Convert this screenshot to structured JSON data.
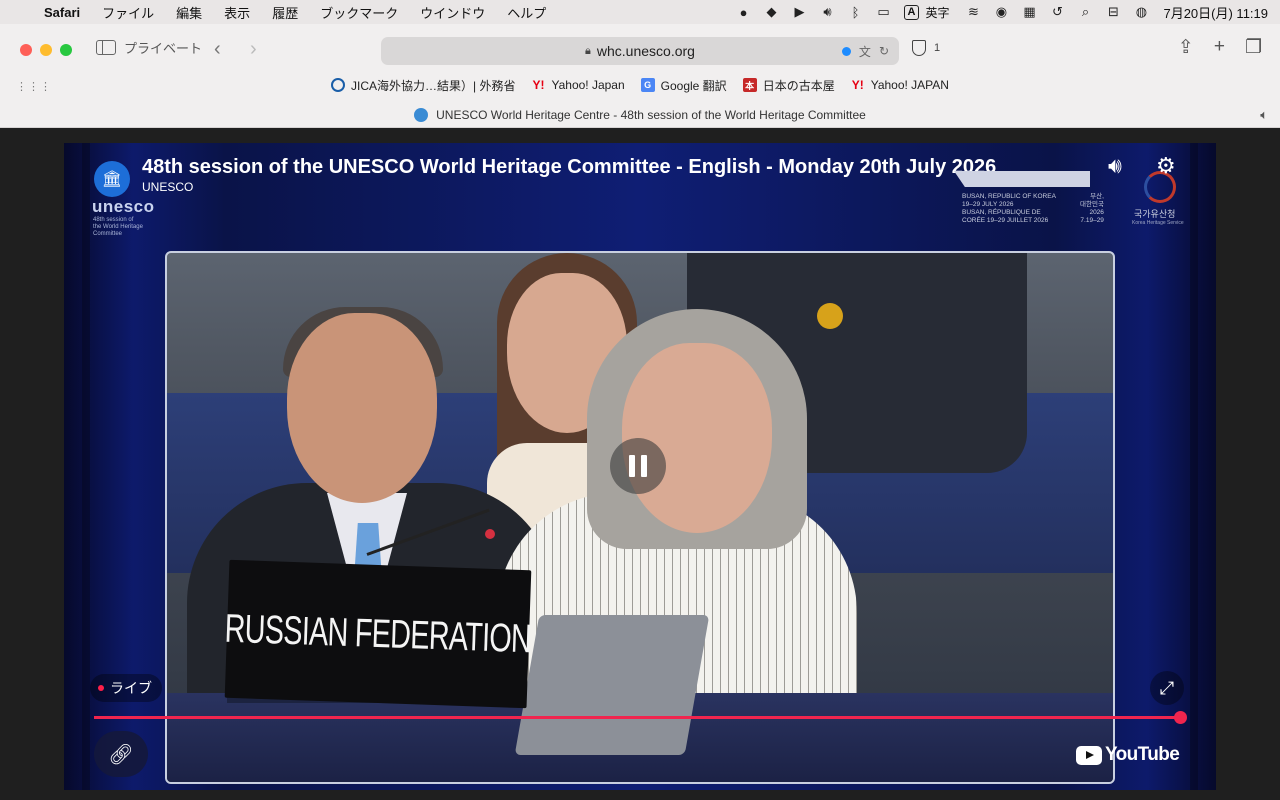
{
  "menubar": {
    "app_name": "Safari",
    "menus": [
      "ファイル",
      "編集",
      "表示",
      "履歴",
      "ブックマーク",
      "ウインドウ",
      "ヘルプ"
    ],
    "input_mode_badge": "A",
    "input_mode_label": "英字",
    "clock": "7月20日(月)  11:19"
  },
  "toolbar": {
    "sidebar_label": "プライベート",
    "url": "whc.unesco.org",
    "blocked_trackers": "1"
  },
  "bookmarks": [
    {
      "label": "JICA海外協力…結果）| 外務省",
      "icon": "jica-icon"
    },
    {
      "label": "Yahoo! Japan",
      "icon": "yahoo-icon"
    },
    {
      "label": "Google 翻訳",
      "icon": "google-translate-icon"
    },
    {
      "label": "日本の古本屋",
      "icon": "kosho-icon"
    },
    {
      "label": "Yahoo! JAPAN",
      "icon": "yahoo-icon"
    }
  ],
  "tab": {
    "title": "UNESCO World Heritage Centre - 48th session of the World Heritage Committee"
  },
  "player": {
    "title": "48th session of the UNESCO World Heritage Committee - English - Monday 20th July 2026",
    "channel": "UNESCO",
    "logo_word": "unesco",
    "logo_sub": "48th session of\nthe World Heritage\nCommittee",
    "banner_en": "BUSAN, REPUBLIC OF KOREA\n19–29 JULY 2026\nBUSAN, RÉPUBLIQUE DE\nCORÉE 19–29 JUILLET 2026",
    "banner_kr": "부산,\n대한민국\n2026\n7.19–29",
    "heritage_name": "국가유산청",
    "heritage_sub": "Korea Heritage Service",
    "nameplate": "RUSSIAN FEDERATION",
    "live_label": "ライブ",
    "progress": 1.0,
    "youtube_label": "YouTube"
  },
  "colors": {
    "progress": "#f0254e",
    "player_bg": "#0f1e74"
  }
}
